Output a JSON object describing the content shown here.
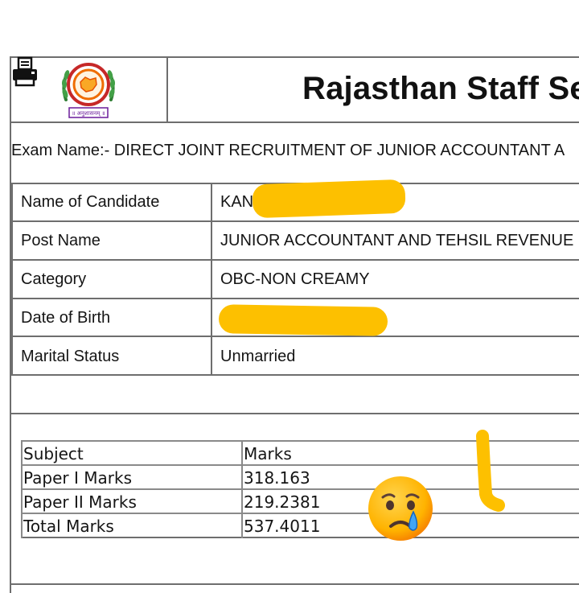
{
  "header": {
    "title": "Rajasthan Staff Se",
    "logo_text": "॥ अनुशासनम् ॥"
  },
  "exam": {
    "label": "Exam Name:- DIRECT JOINT RECRUITMENT OF JUNIOR ACCOUNTANT A"
  },
  "candidate_details": [
    {
      "label": "Name of Candidate",
      "value": "KAN"
    },
    {
      "label": "Post Name",
      "value": "JUNIOR ACCOUNTANT AND TEHSIL REVENUE"
    },
    {
      "label": "Category",
      "value": "OBC-NON CREAMY"
    },
    {
      "label": "Date of Birth",
      "value": ""
    },
    {
      "label": "Marital Status",
      "value": "Unmarried"
    }
  ],
  "marks": {
    "headers": [
      "Subject",
      "Marks"
    ],
    "rows": [
      {
        "subject": "Paper I Marks",
        "marks": "318.163"
      },
      {
        "subject": "Paper II Marks",
        "marks": "219.2381"
      },
      {
        "subject": "Total Marks",
        "marks": "537.4011"
      }
    ]
  },
  "colors": {
    "redaction": "#fdc000",
    "border": "#6e6e6e",
    "text": "#151515"
  },
  "icons": [
    "printer-icon",
    "rssb-logo",
    "crying-face-emoji"
  ]
}
